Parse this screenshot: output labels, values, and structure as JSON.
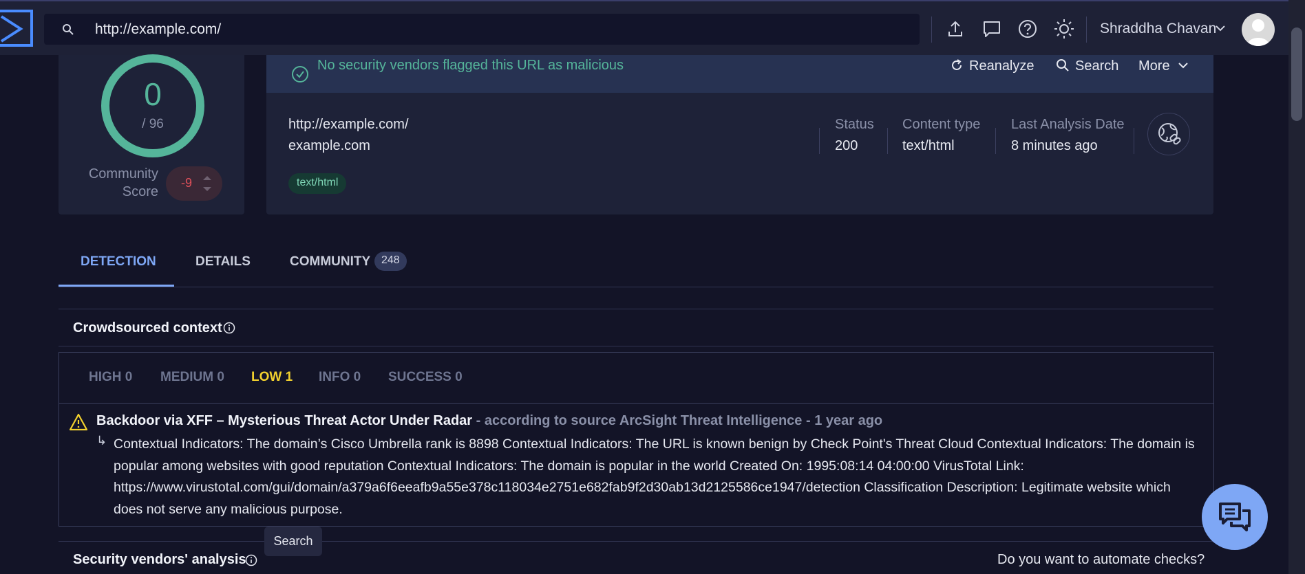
{
  "topbar": {
    "url": "http://example.com/",
    "username": "Shraddha Chavan",
    "icons": [
      "upload-icon",
      "comment-icon",
      "help-icon",
      "theme-icon"
    ]
  },
  "score": {
    "detections": "0",
    "total": "/ 96",
    "community_label": "Community Score",
    "community_value": "-9"
  },
  "banner": {
    "message": "No security vendors flagged this URL as malicious",
    "reanalyze": "Reanalyze",
    "search": "Search",
    "more": "More"
  },
  "info": {
    "url": "http://example.com/",
    "domain": "example.com",
    "tag": "text/html",
    "status_label": "Status",
    "status_value": "200",
    "content_type_label": "Content type",
    "content_type_value": "text/html",
    "last_analysis_label": "Last Analysis Date",
    "last_analysis_value": "8 minutes ago"
  },
  "tabs": {
    "detection": "DETECTION",
    "details": "DETAILS",
    "community": "COMMUNITY",
    "community_count": "248"
  },
  "crowdsourced": {
    "title": "Crowdsourced context",
    "filters": {
      "high": "HIGH 0",
      "medium": "MEDIUM 0",
      "low": "LOW 1",
      "info": "INFO 0",
      "success": "SUCCESS 0"
    },
    "alert_title": "Backdoor via XFF – Mysterious Threat Actor Under Radar",
    "alert_source": " - according to source ArcSight Threat Intelligence - 1 year ago",
    "alert_arrow": "↳",
    "alert_body": "Contextual Indicators: The domain’s Cisco Umbrella rank is 8898 Contextual Indicators: The URL is known benign by Check Point's Threat Cloud Contextual Indicators: The domain is popular among websites with good reputation Contextual Indicators: The domain is popular in the world Created On: 1995:08:14 04:00:00 VirusTotal Link: https://www.virustotal.com/gui/domain/a379a6f6eeafb9a55e378c118034e2751e682fab9f2d30ab13d2125586ce1947/detection Classification Description: Legitimate website which does not serve any malicious purpose."
  },
  "vendors": {
    "title": "Security vendors' analysis",
    "automate": "Do you want to automate checks?"
  },
  "tooltip": "Search",
  "colors": {
    "background": "#131427",
    "card": "#1e2238",
    "accent": "#7ea7f5",
    "safe": "#55b59a",
    "negative": "#e0505a",
    "low": "#f2d12e"
  }
}
